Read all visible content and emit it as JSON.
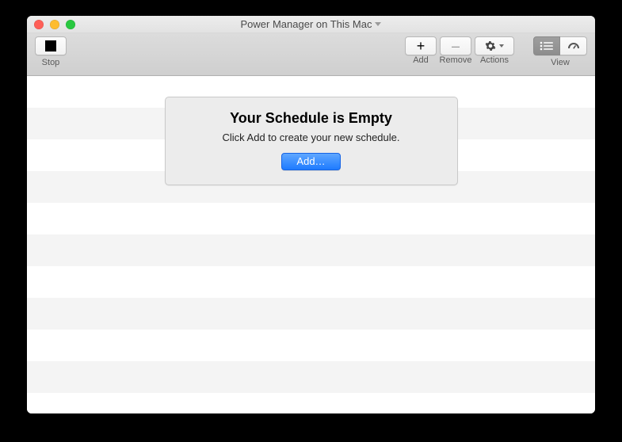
{
  "window": {
    "title": "Power Manager on This Mac"
  },
  "toolbar": {
    "stop_label": "Stop",
    "add_label": "Add",
    "remove_label": "Remove",
    "actions_label": "Actions",
    "view_label": "View"
  },
  "empty_state": {
    "title": "Your Schedule is Empty",
    "subtitle": "Click Add to create your new schedule.",
    "button": "Add…"
  }
}
